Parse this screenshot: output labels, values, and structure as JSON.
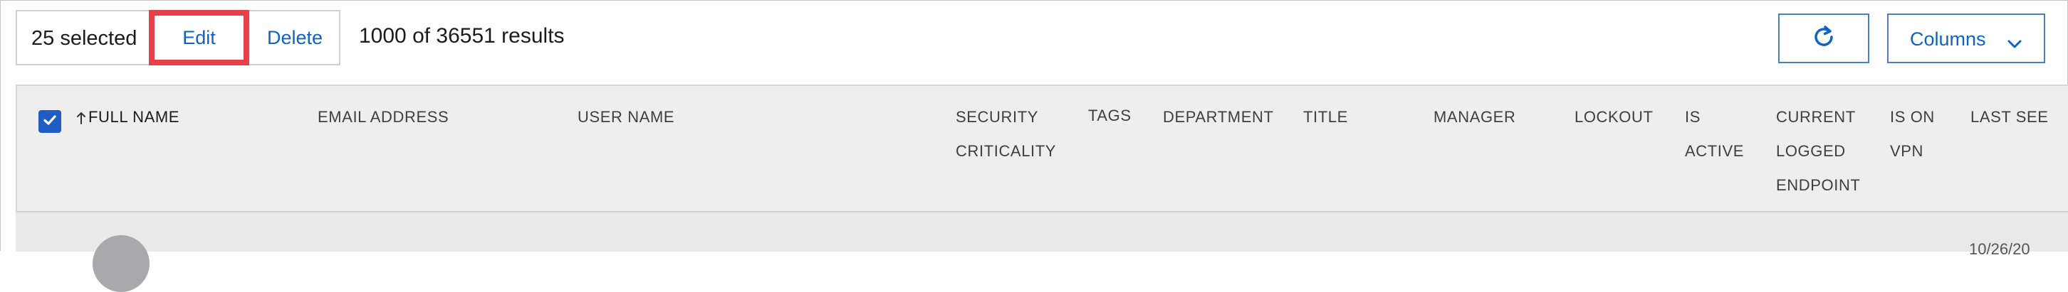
{
  "toolbar": {
    "selected_text": "25 selected",
    "edit_label": "Edit",
    "delete_label": "Delete",
    "results_text": "1000 of 36551 results",
    "refresh_icon": "refresh-icon",
    "columns_label": "Columns",
    "columns_icon": "chevron-down-icon"
  },
  "table": {
    "select_all_checked": true,
    "sorted_column": "FULL NAME",
    "sort_direction": "ascending",
    "headers": {
      "full_name": "FULL NAME",
      "email_address": "EMAIL ADDRESS",
      "user_name": "USER NAME",
      "security_criticality_1": "SECURITY",
      "security_criticality_2": "CRITICALITY",
      "tags": "TAGS",
      "department": "DEPARTMENT",
      "title": "TITLE",
      "manager": "MANAGER",
      "lockout": "LOCKOUT",
      "is_active_1": "IS",
      "is_active_2": "ACTIVE",
      "current_endpoint_1": "CURRENT",
      "current_endpoint_2": "LOGGED",
      "current_endpoint_3": "ENDPOINT",
      "is_on_vpn_1": "IS ON",
      "is_on_vpn_2": "VPN",
      "last_seen": "LAST SEE"
    },
    "first_row_date_partial": "10/26/20"
  },
  "colors": {
    "accent": "#0f62c6",
    "highlight_border": "#e83f48",
    "checkbox": "#1f5cc4",
    "header_bg": "#eeeeee"
  }
}
